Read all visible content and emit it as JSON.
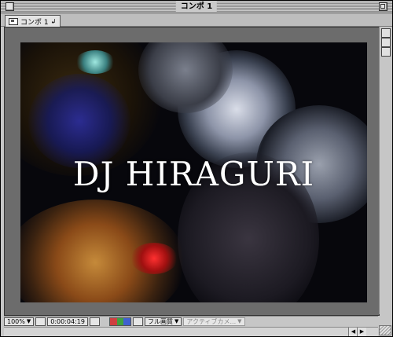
{
  "window": {
    "title": "コンポ 1"
  },
  "tab": {
    "label": "コンポ 1",
    "close_glyph": "↲"
  },
  "viewer": {
    "overlay_text": "DJ HIRAGURI"
  },
  "statusbar": {
    "zoom": "100%",
    "timecode": "0:00:04:19",
    "resolution": "フル画質",
    "camera": "アクティブカメ..."
  },
  "colors": {
    "window_bg": "#c6c6c6",
    "viewer_bg": "#6c6c6c",
    "text_white": "#ffffff",
    "channel_red": "#d04040",
    "channel_green": "#40a040",
    "channel_blue": "#4060d0"
  }
}
